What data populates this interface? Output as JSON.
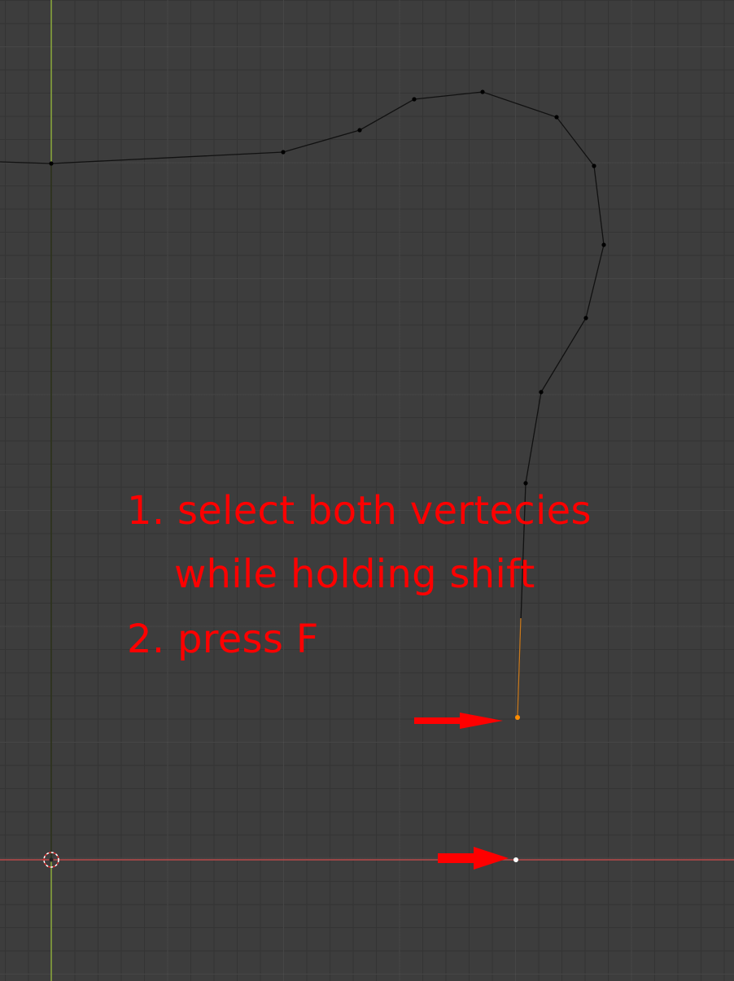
{
  "viewport": {
    "background": "#3d3d3d",
    "grid_minor_color": "#343434",
    "grid_major_color": "#555555",
    "axis_y_color": "#8aa83a",
    "axis_x_color": "#b84a4a"
  },
  "annotation": {
    "line1": "1. select both vertecies",
    "line2": "while holding shift",
    "line3": "2. press F",
    "color": "#ff0000"
  },
  "mesh": {
    "edge_color": "#111111",
    "vertex_color": "#000000",
    "selected_vertex_color": "#ff8c00",
    "active_vertex_color": "#ffffff"
  },
  "icons": {
    "origin": "3d-cursor-icon",
    "arrow": "right-arrow-icon"
  }
}
